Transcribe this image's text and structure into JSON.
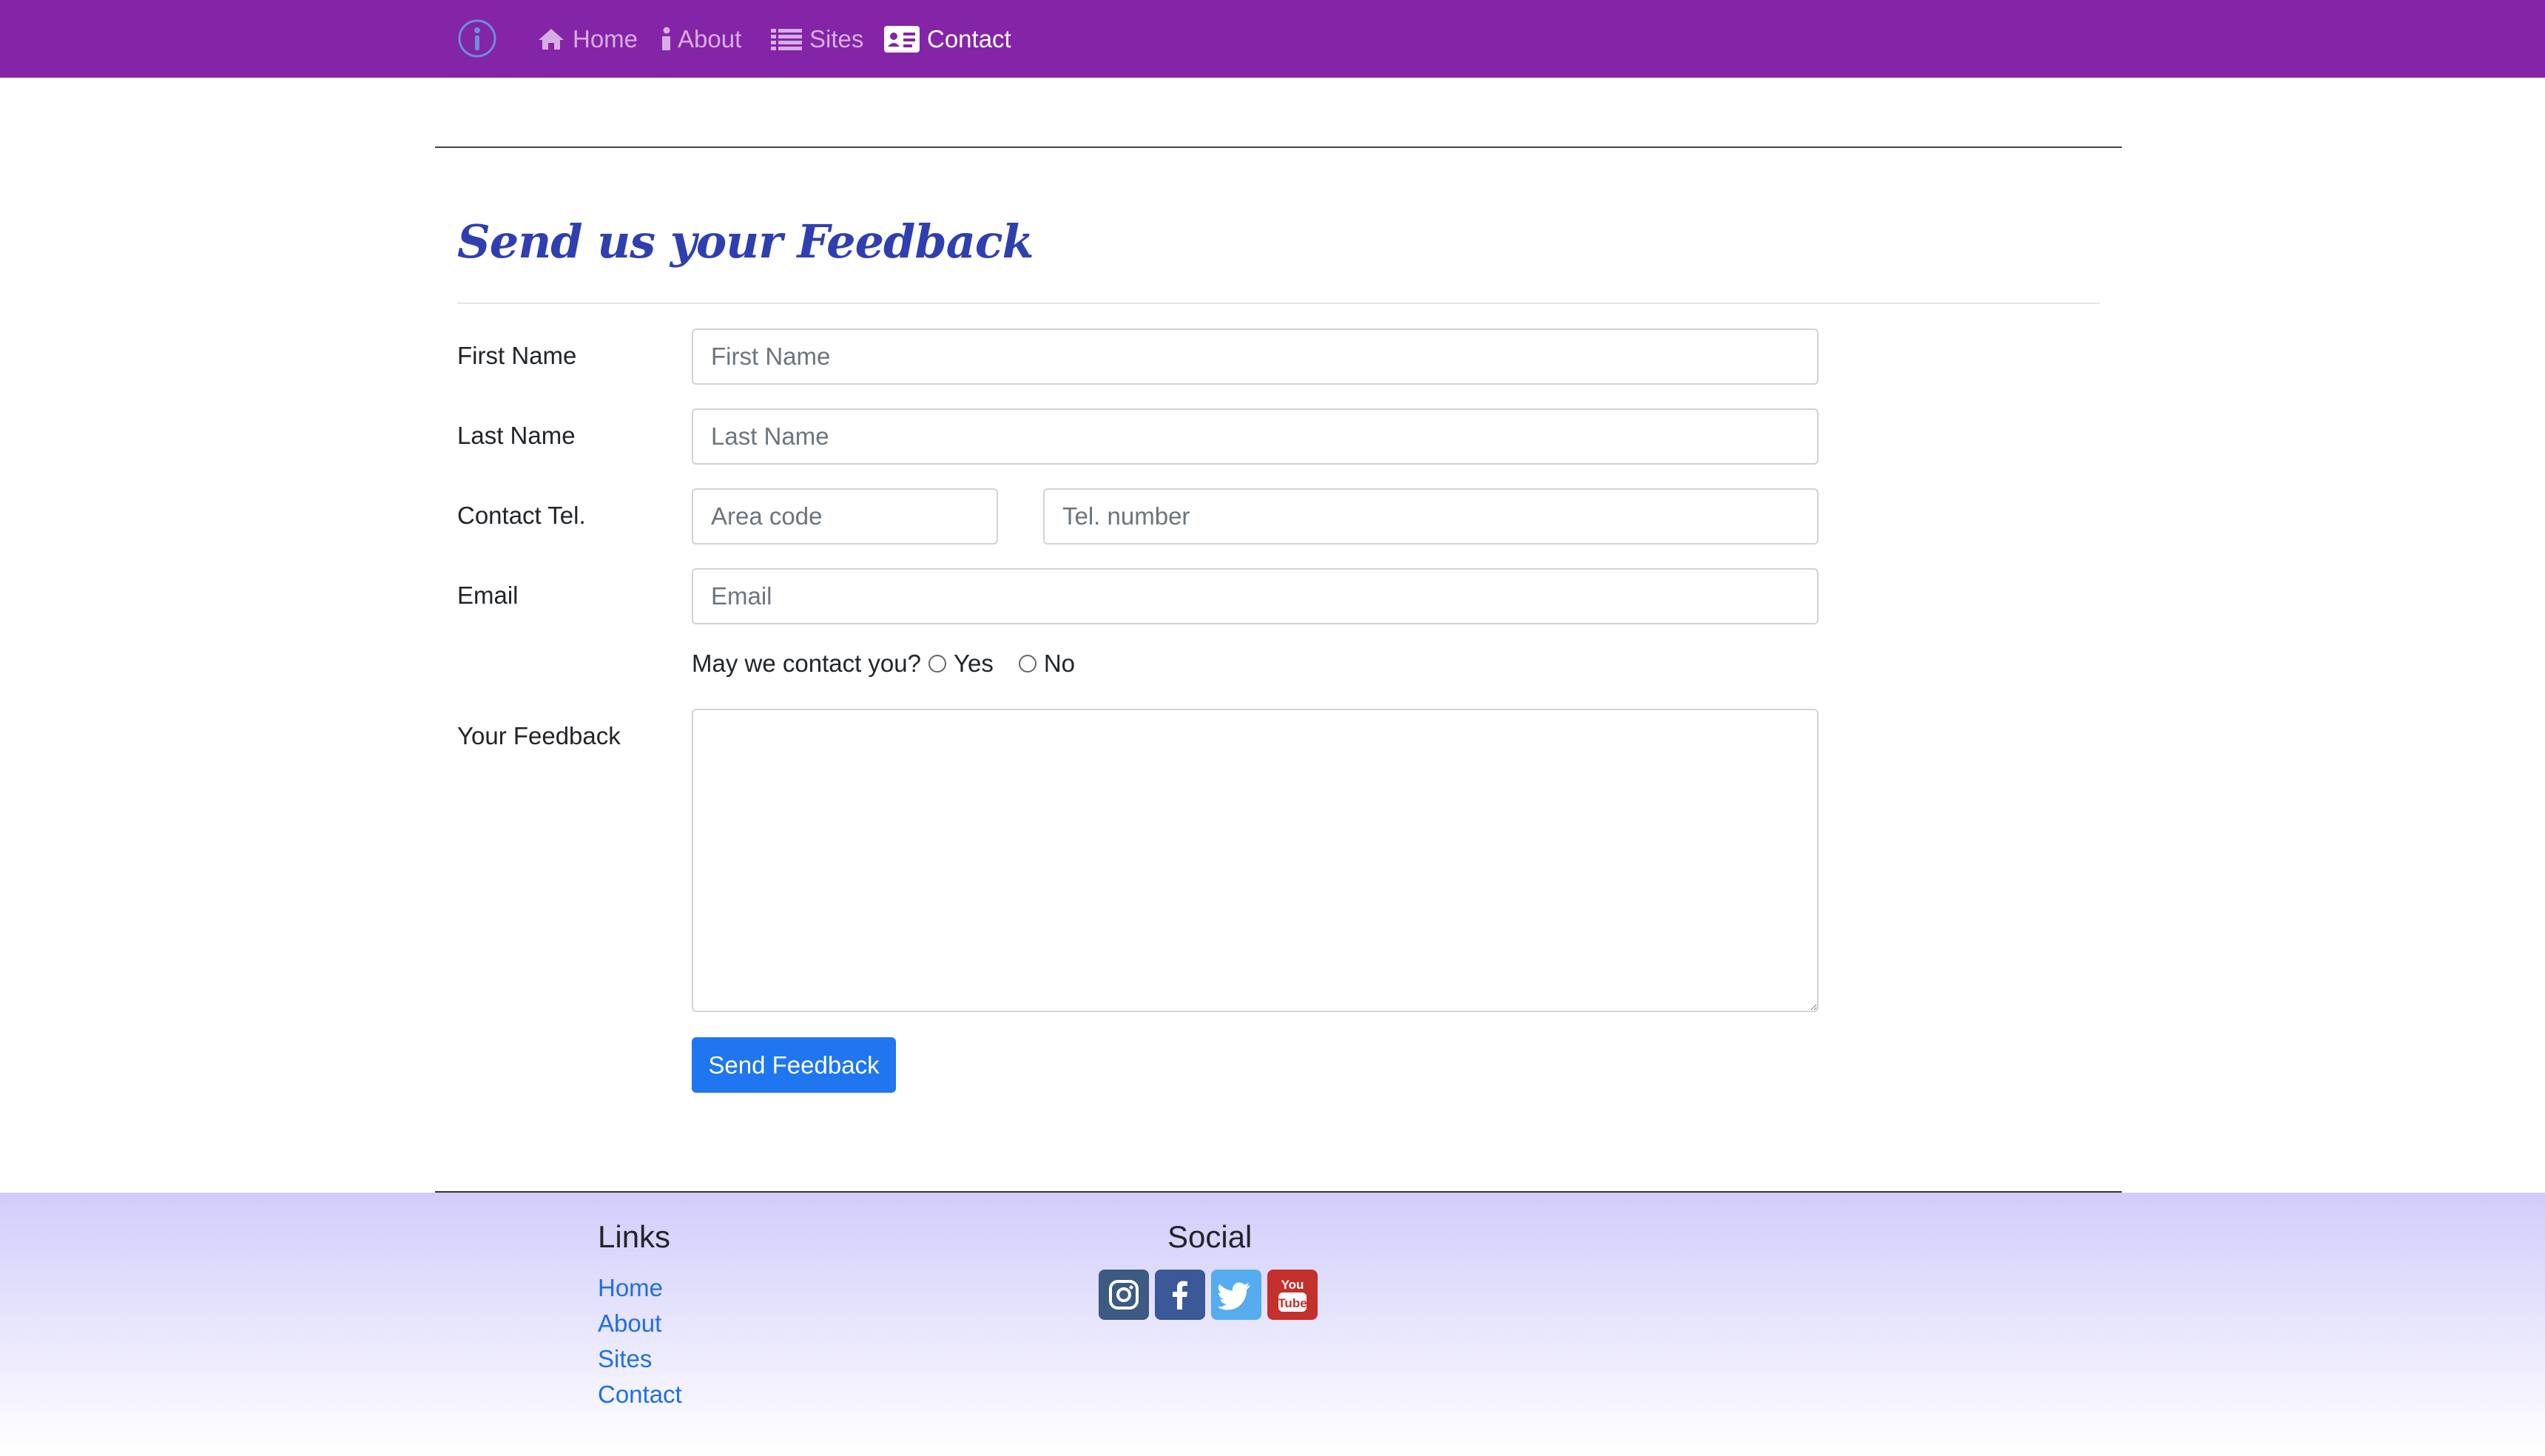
{
  "nav": {
    "brand_icon": "info-logo-icon",
    "items": [
      {
        "label": "Home",
        "icon": "home-icon"
      },
      {
        "label": "About",
        "icon": "info-icon"
      },
      {
        "label": "Sites",
        "icon": "list-icon"
      },
      {
        "label": "Contact",
        "icon": "contact-card-icon",
        "active": true
      }
    ]
  },
  "form": {
    "title": "Send us your Feedback",
    "first_name": {
      "label": "First Name",
      "placeholder": "First Name"
    },
    "last_name": {
      "label": "Last Name",
      "placeholder": "Last Name"
    },
    "tel": {
      "label": "Contact Tel.",
      "area_placeholder": "Area code",
      "number_placeholder": "Tel. number"
    },
    "email": {
      "label": "Email",
      "placeholder": "Email"
    },
    "contact_question": "May we contact you?",
    "yes_label": "Yes",
    "no_label": "No",
    "feedback_label": "Your Feedback",
    "submit_label": "Send Feedback"
  },
  "footer": {
    "links_heading": "Links",
    "links": [
      "Home",
      "About",
      "Sites",
      "Contact"
    ],
    "social_heading": "Social",
    "social": [
      {
        "name": "instagram-icon",
        "color": "#3d5a80"
      },
      {
        "name": "facebook-icon",
        "color": "#3b5998"
      },
      {
        "name": "twitter-icon",
        "color": "#55acee"
      },
      {
        "name": "youtube-icon",
        "color": "#c4302b"
      }
    ]
  },
  "colors": {
    "navbar": "#8424a7",
    "title": "#2f3fb0",
    "button": "#1f76f0",
    "link": "#1f6ee8"
  }
}
